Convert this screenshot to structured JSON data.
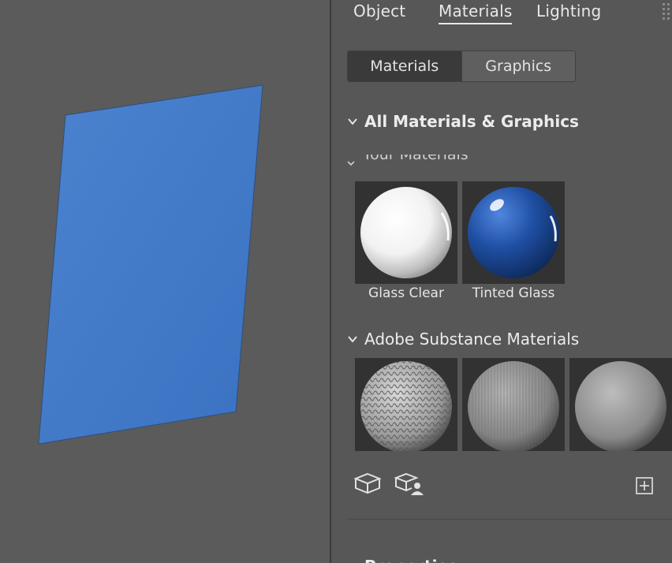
{
  "tabs": [
    {
      "label": "Object"
    },
    {
      "label": "Materials"
    },
    {
      "label": "Lighting"
    }
  ],
  "segmented": {
    "materials": "Materials",
    "graphics": "Graphics"
  },
  "sections": {
    "all": "All Materials & Graphics",
    "yours": "Your Materials",
    "substance": "Adobe Substance Materials",
    "properties": "Properties"
  },
  "your_materials": [
    {
      "name": "Glass Clear"
    },
    {
      "name": "Tinted Glass"
    }
  ],
  "colors": {
    "shape_fill": "#3f78c7",
    "tinted_glass": "#1f4fa3"
  },
  "icons": [
    "materials-icon",
    "shared-materials-icon",
    "add-icon",
    "grip-icon"
  ]
}
